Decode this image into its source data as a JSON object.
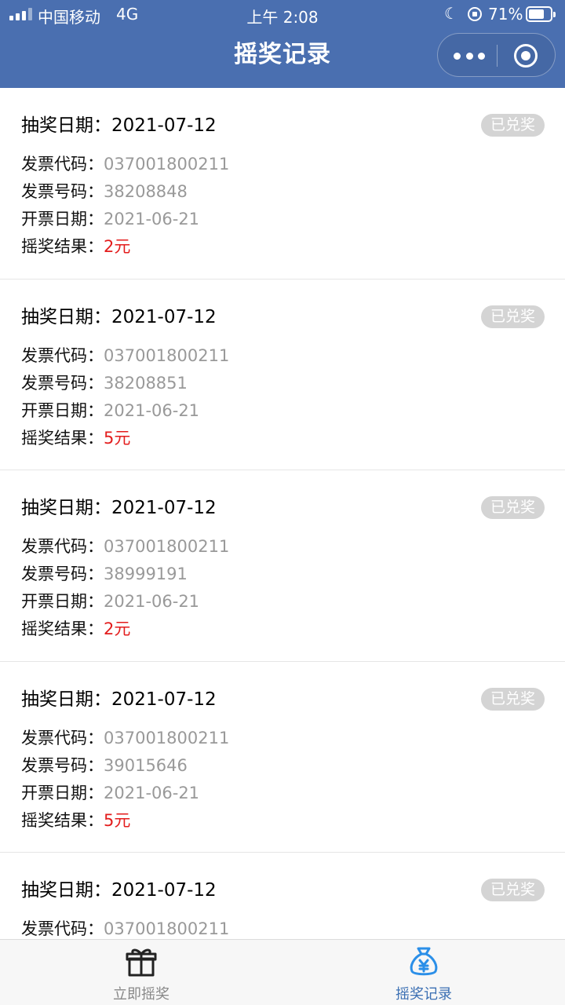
{
  "status_bar": {
    "carrier": "中国移动",
    "network": "4G",
    "time": "上午 2:08",
    "battery": "71%",
    "battery_level": 0.71
  },
  "nav": {
    "title": "摇奖记录"
  },
  "records": [
    {
      "draw_label": "抽奖日期：",
      "draw_date": "2021-07-12",
      "status": "已兑奖",
      "code_label": "发票代码：",
      "code": "037001800211",
      "number_label": "发票号码：",
      "number": "38208848",
      "issue_label": "开票日期：",
      "issue_date": "2021-06-21",
      "result_label": "摇奖结果：",
      "result": "2元"
    },
    {
      "draw_label": "抽奖日期：",
      "draw_date": "2021-07-12",
      "status": "已兑奖",
      "code_label": "发票代码：",
      "code": "037001800211",
      "number_label": "发票号码：",
      "number": "38208851",
      "issue_label": "开票日期：",
      "issue_date": "2021-06-21",
      "result_label": "摇奖结果：",
      "result": "5元"
    },
    {
      "draw_label": "抽奖日期：",
      "draw_date": "2021-07-12",
      "status": "已兑奖",
      "code_label": "发票代码：",
      "code": "037001800211",
      "number_label": "发票号码：",
      "number": "38999191",
      "issue_label": "开票日期：",
      "issue_date": "2021-06-21",
      "result_label": "摇奖结果：",
      "result": "2元"
    },
    {
      "draw_label": "抽奖日期：",
      "draw_date": "2021-07-12",
      "status": "已兑奖",
      "code_label": "发票代码：",
      "code": "037001800211",
      "number_label": "发票号码：",
      "number": "39015646",
      "issue_label": "开票日期：",
      "issue_date": "2021-06-21",
      "result_label": "摇奖结果：",
      "result": "5元"
    },
    {
      "draw_label": "抽奖日期：",
      "draw_date": "2021-07-12",
      "status": "已兑奖",
      "code_label": "发票代码：",
      "code": "037001800211"
    }
  ],
  "tabbar": {
    "tabs": [
      {
        "label": "立即摇奖",
        "icon": "gift-icon",
        "active": false
      },
      {
        "label": "摇奖记录",
        "icon": "money-bag-icon",
        "active": true
      }
    ]
  },
  "colors": {
    "header_bg": "#4a6fb0",
    "result_red": "#e31c1c",
    "muted_value": "#999999",
    "badge_bg": "#d4d4d4",
    "tab_active": "#3b6fb3",
    "tab_inactive": "#888888"
  }
}
